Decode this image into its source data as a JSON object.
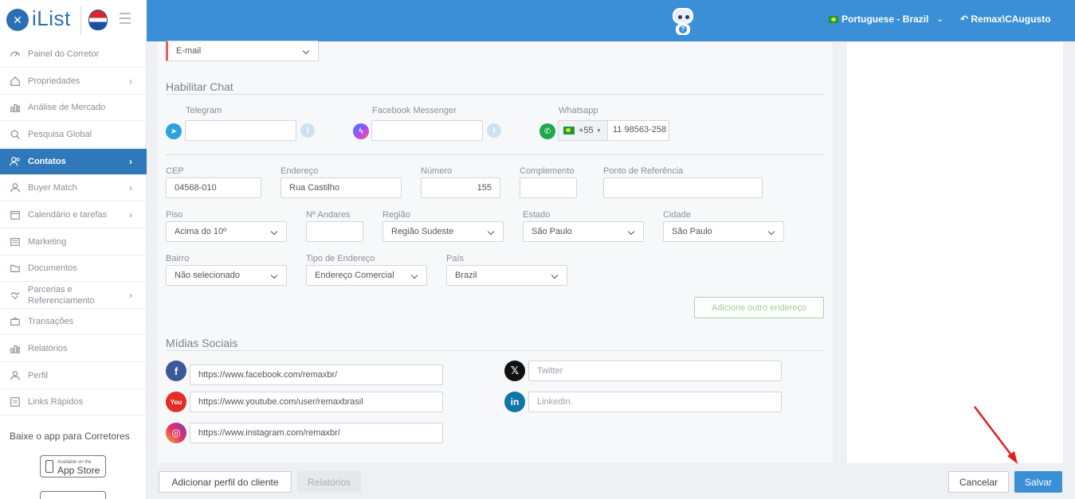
{
  "header": {
    "logo_text": "iList",
    "language": "Portuguese - Brazil",
    "user": "Remax\\CAugusto"
  },
  "sidebar": {
    "items": [
      {
        "label": "Painel do Corretor",
        "icon": "gauge-icon",
        "caret": false
      },
      {
        "label": "Propriedades",
        "icon": "home-icon",
        "caret": true
      },
      {
        "label": "Análise de Mercado",
        "icon": "bar-chart-icon",
        "caret": false
      },
      {
        "label": "Pesquisa Global",
        "icon": "search-icon",
        "caret": false
      },
      {
        "label": "Contatos",
        "icon": "contacts-icon",
        "caret": true,
        "active": true
      },
      {
        "label": "Buyer Match",
        "icon": "user-icon",
        "caret": true
      },
      {
        "label": "Calendário e tarefas",
        "icon": "calendar-icon",
        "caret": true
      },
      {
        "label": "Marketing",
        "icon": "newspaper-icon",
        "caret": false
      },
      {
        "label": "Documentos",
        "icon": "folder-icon",
        "caret": false
      },
      {
        "label": "Parcerias e Referenciamento",
        "icon": "handshake-icon",
        "caret": true
      },
      {
        "label": "Transações",
        "icon": "briefcase-icon",
        "caret": false
      },
      {
        "label": "Relatórios",
        "icon": "bar-chart-icon",
        "caret": false
      },
      {
        "label": "Perfil",
        "icon": "user-icon",
        "caret": false
      },
      {
        "label": "Links Rápidos",
        "icon": "list-icon",
        "caret": false
      }
    ],
    "app_title": "Baixe o app para Corretores",
    "app_store_small": "Available on the",
    "app_store_big": "App Store"
  },
  "form": {
    "email_select": "E-mail",
    "chat": {
      "title": "Habilitar Chat",
      "telegram_label": "Telegram",
      "messenger_label": "Facebook Messenger",
      "whatsapp_label": "Whatsapp",
      "whatsapp_prefix": "+55",
      "whatsapp_number": "11 98563-258"
    },
    "address": {
      "cep_label": "CEP",
      "cep": "04568-010",
      "endereco_label": "Endereço",
      "endereco": "Rua Castilho",
      "numero_label": "Número",
      "numero": "155",
      "complemento_label": "Complemento",
      "referencia_label": "Ponto de Referência",
      "piso_label": "Piso",
      "piso": "Acima do 10º",
      "andares_label": "Nº Andares",
      "regiao_label": "Região",
      "regiao": "Região Sudeste",
      "estado_label": "Estado",
      "estado": "São Paulo",
      "cidade_label": "Cidade",
      "cidade": "São Paulo",
      "bairro_label": "Bairro",
      "bairro": "Não selecionado",
      "tipo_label": "Tipo de Endereço",
      "tipo": "Endereço Comercial",
      "pais_label": "País",
      "pais": "Brazil",
      "add_button": "Adicione outro endereço"
    },
    "social": {
      "title": "Mídias Sociais",
      "facebook": "https://www.facebook.com/remaxbr/",
      "youtube": "https://www.youtube.com/user/remaxbrasil",
      "instagram": "https://www.instagram.com/remaxbr/",
      "twitter_placeholder": "Twitter",
      "linkedin_placeholder": "LinkedIn."
    }
  },
  "footer": {
    "add_profile": "Adicionar perfil do cliente",
    "reports": "Relatórios",
    "cancel": "Cancelar",
    "save": "Salvar"
  },
  "colors": {
    "header_blue": "#3a8fd6",
    "active_nav": "#2f78b9",
    "annotation_arrow": "#e02020"
  }
}
